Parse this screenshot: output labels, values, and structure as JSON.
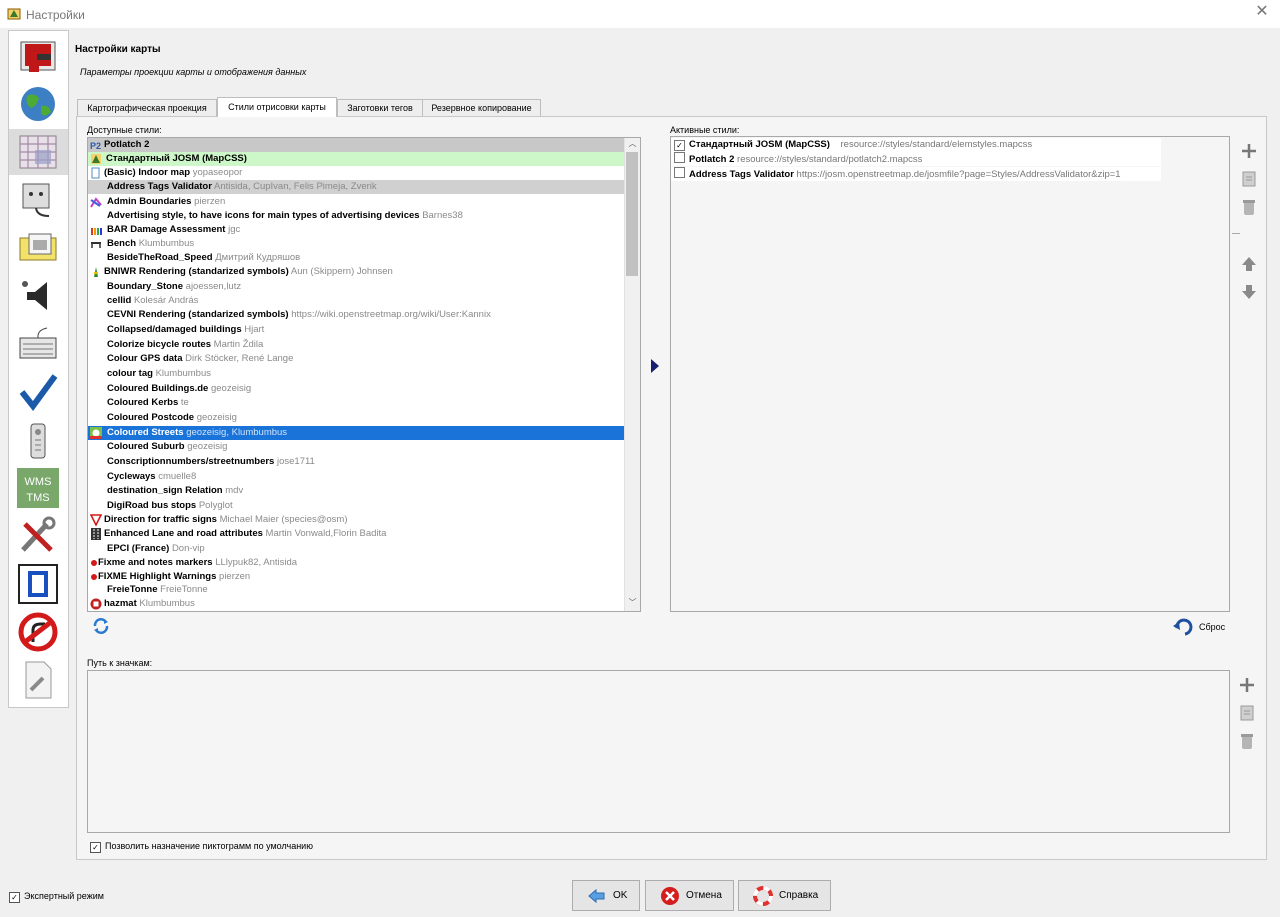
{
  "window": {
    "title": "Настройки"
  },
  "pane": {
    "title": "Настройки карты",
    "subtitle": "Параметры проекции карты и отображения данных"
  },
  "tabs": [
    {
      "label": "Картографическая проекция"
    },
    {
      "label": "Стили отрисовки карты"
    },
    {
      "label": "Заготовки тегов"
    },
    {
      "label": "Резервное копирование"
    }
  ],
  "available": {
    "label": "Доступные стили:",
    "rows": [
      {
        "name": "Potlatch 2",
        "author": "",
        "icon": "p2-icon"
      },
      {
        "name": "Стандартный JOSM (MapCSS)",
        "author": "",
        "icon": "josm-logo-icon"
      },
      {
        "name": "(Basic) Indoor map",
        "author": "yopaseopor",
        "icon": "page-icon"
      },
      {
        "name": "Address Tags Validator",
        "author": "Antisida, CupIvan, Felis Pimeja, Zverik",
        "icon": ""
      },
      {
        "name": "Admin Boundaries",
        "author": "pierzen",
        "icon": "boundary-icon"
      },
      {
        "name": "Advertising style, to have icons for main types of advertising devices",
        "author": "Barnes38",
        "icon": ""
      },
      {
        "name": "BAR Damage Assessment",
        "author": "jgc",
        "icon": "bars-icon"
      },
      {
        "name": "Bench",
        "author": "Klumbumbus",
        "icon": "bench-icon"
      },
      {
        "name": "BesideTheRoad_Speed",
        "author": "Дмитрий Кудряшов",
        "icon": ""
      },
      {
        "name": "BNIWR Rendering (standarized symbols)",
        "author": "Aun (Skippern) Johnsen",
        "icon": "buoy-icon"
      },
      {
        "name": "Boundary_Stone",
        "author": "ajoessen,lutz",
        "icon": ""
      },
      {
        "name": "cellid",
        "author": "Kolesár András",
        "icon": ""
      },
      {
        "name": "CEVNI Rendering (standarized symbols)",
        "author": "https://wiki.openstreetmap.org/wiki/User:Kannix",
        "icon": ""
      },
      {
        "name": "Collapsed/damaged buildings",
        "author": "Hjart",
        "icon": ""
      },
      {
        "name": "Colorize bicycle routes",
        "author": "Martin Ždila",
        "icon": ""
      },
      {
        "name": "Colour GPS data",
        "author": "Dirk Stöcker, René Lange",
        "icon": ""
      },
      {
        "name": "colour tag",
        "author": "Klumbumbus",
        "icon": ""
      },
      {
        "name": "Coloured Buildings.de",
        "author": "geozeisig",
        "icon": ""
      },
      {
        "name": "Coloured Kerbs",
        "author": "te",
        "icon": ""
      },
      {
        "name": "Coloured Postcode",
        "author": "geozeisig",
        "icon": ""
      },
      {
        "name": "Coloured Streets",
        "author": "geozeisig, Klumbumbus",
        "icon": "streets-icon"
      },
      {
        "name": "Coloured Suburb",
        "author": "geozeisig",
        "icon": ""
      },
      {
        "name": "Conscriptionnumbers/streetnumbers",
        "author": "jose1711",
        "icon": ""
      },
      {
        "name": "Cycleways",
        "author": "cmuelle8",
        "icon": ""
      },
      {
        "name": "destination_sign Relation",
        "author": "mdv",
        "icon": ""
      },
      {
        "name": "DigiRoad bus stops",
        "author": "Polyglot",
        "icon": ""
      },
      {
        "name": "Direction for traffic signs",
        "author": "Michael Maier (species@osm)",
        "icon": "yield-sign-icon"
      },
      {
        "name": "Enhanced Lane and road attributes",
        "author": "Martin Vonwald,Florin Badita",
        "icon": "lanes-icon"
      },
      {
        "name": "EPCI (France)",
        "author": "Don-vip",
        "icon": ""
      },
      {
        "name": "Fixme and notes markers",
        "author": "LLlypuk82, Antisida",
        "icon": "red-dot-icon"
      },
      {
        "name": "FIXME Highlight Warnings",
        "author": "pierzen",
        "icon": "red-dot-icon"
      },
      {
        "name": "FreieTonne",
        "author": "FreieTonne",
        "icon": ""
      },
      {
        "name": "hazmat",
        "author": "Klumbumbus",
        "icon": "hazmat-icon"
      }
    ]
  },
  "active": {
    "label": "Активные стили:",
    "rows": [
      {
        "checked": true,
        "name": "Стандартный JOSM (MapCSS)",
        "source": "resource://styles/standard/elemstyles.mapcss"
      },
      {
        "checked": false,
        "name": "Potlatch 2",
        "source": "resource://styles/standard/potlatch2.mapcss"
      },
      {
        "checked": false,
        "name": "Address Tags Validator",
        "source": "https://josm.openstreetmap.de/josmfile?page=Styles/AddressValidator&zip=1"
      }
    ],
    "reset_label": "Сброс"
  },
  "icons_path": {
    "label": "Путь к значкам:"
  },
  "default_icons": {
    "label": "Позволить назначение пиктограмм по умолчанию",
    "checked": true
  },
  "expert_mode": {
    "label": "Экспертный режим",
    "checked": true
  },
  "buttons": {
    "ok": "OK",
    "cancel": "Отмена",
    "help": "Справка"
  },
  "colors": {
    "selection": "#1a73d8",
    "highlight_green": "#cdf7c9",
    "accent_dark": "#17206e"
  }
}
